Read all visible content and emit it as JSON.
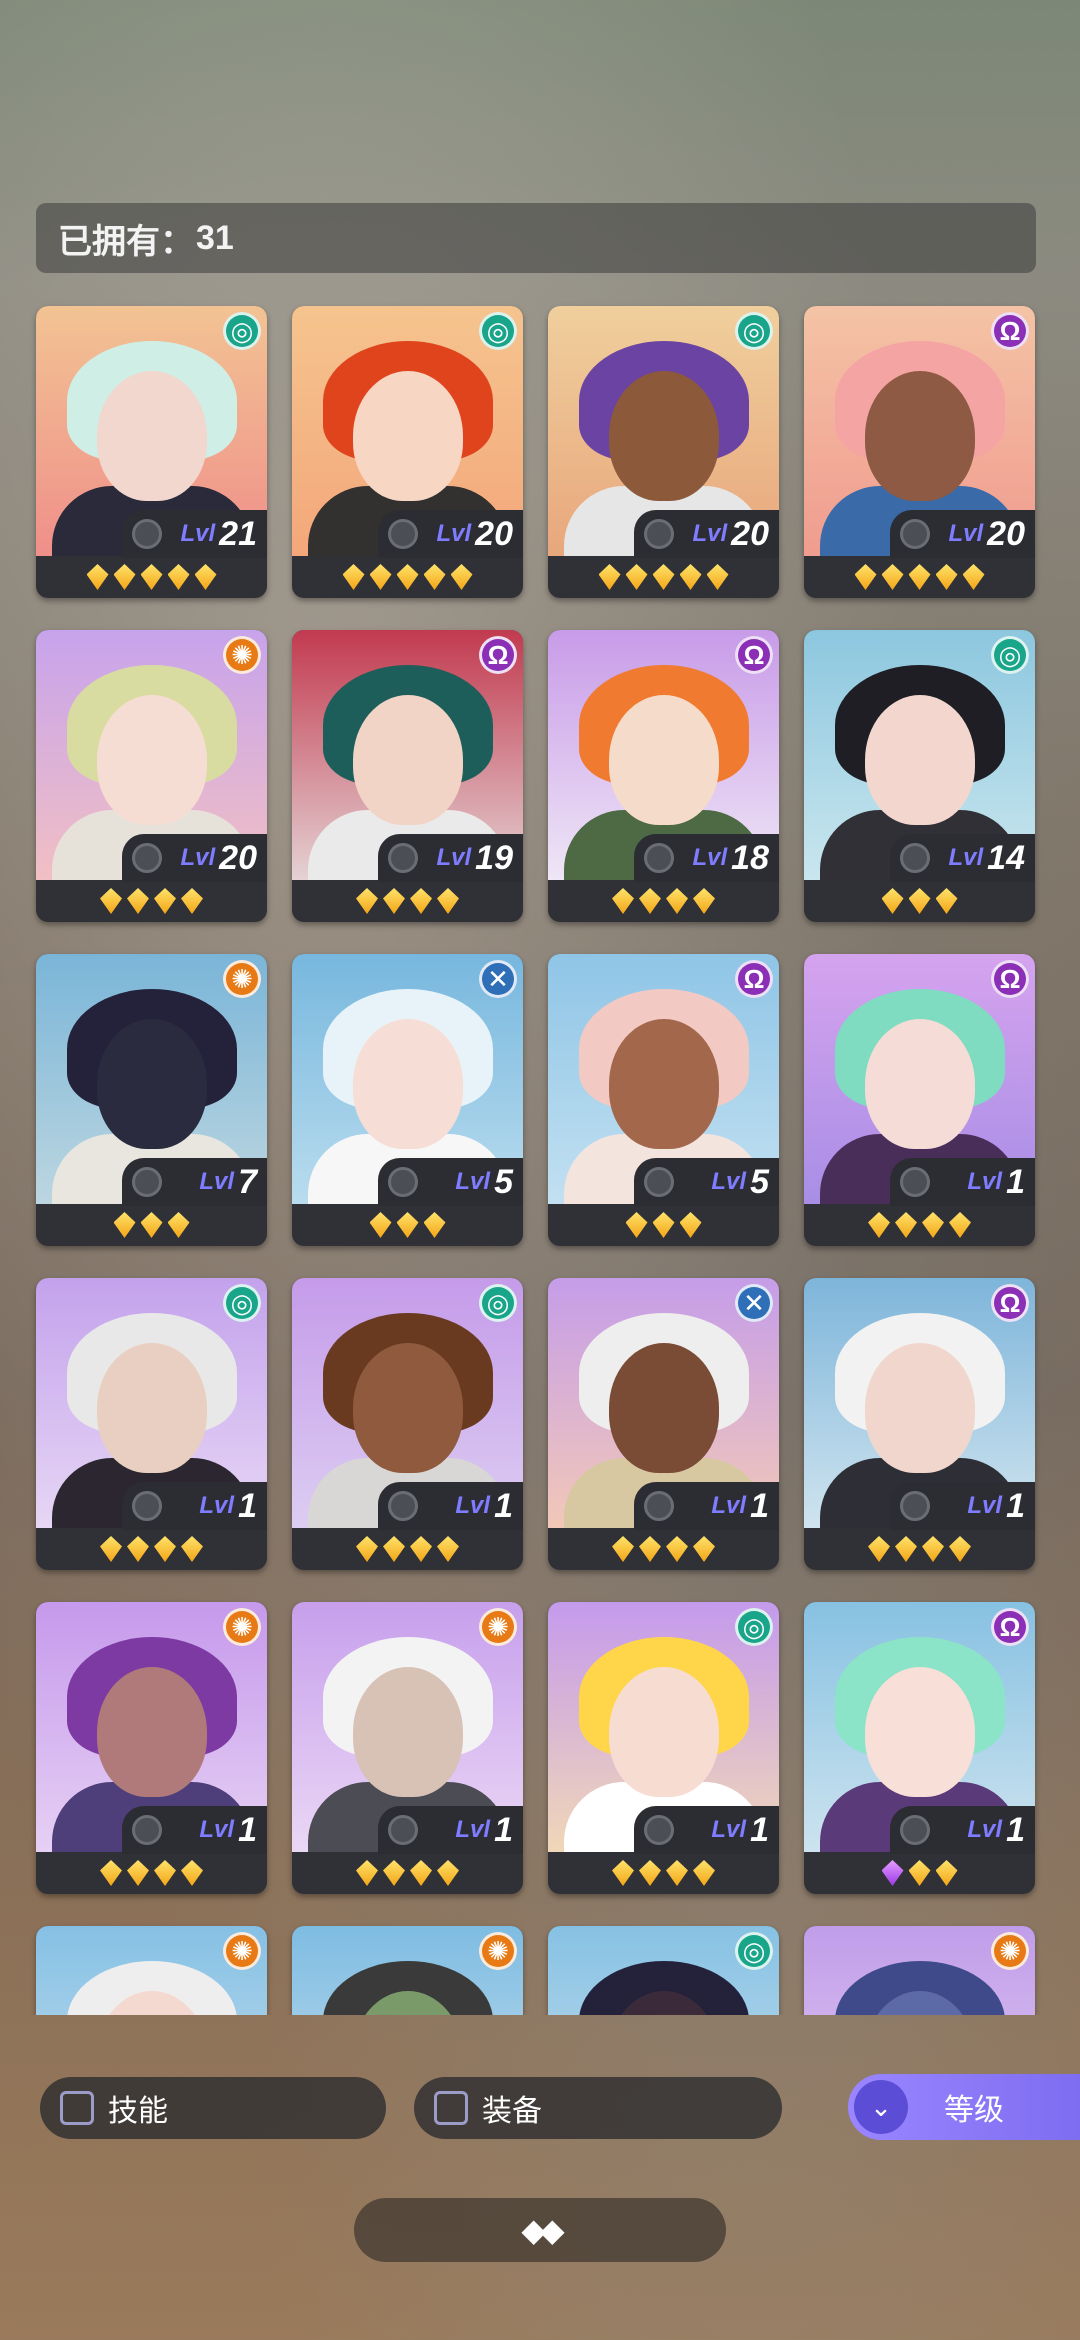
{
  "header": {
    "owned_label": "已拥有：",
    "owned_count": "31"
  },
  "colors": {
    "accent": "#7d6cf0",
    "level_text": "#7f7cff",
    "star_gold": "#f3a516",
    "star_purple": "#9b38e6"
  },
  "filters": {
    "skill_label": "技能",
    "equip_label": "装备",
    "sort_label": "等级"
  },
  "cards": [
    {
      "level": "21",
      "element": "spiral",
      "stars": 5,
      "bg": [
        "#f2c393",
        "#f08f8a"
      ],
      "hair": "#cfeee5",
      "skin": "#f2d7cf",
      "outfit": "#2a2a3a"
    },
    {
      "level": "20",
      "element": "spiral",
      "stars": 5,
      "bg": [
        "#f5c48e",
        "#f4a77b"
      ],
      "hair": "#e0441c",
      "skin": "#f7d6c3",
      "outfit": "#333030"
    },
    {
      "level": "20",
      "element": "spiral",
      "stars": 5,
      "bg": [
        "#f0cf9d",
        "#e8a77c"
      ],
      "hair": "#6b43a3",
      "skin": "#8c5a3a",
      "outfit": "#e6e6e6"
    },
    {
      "level": "20",
      "element": "kaiju",
      "stars": 5,
      "bg": [
        "#f4c3a5",
        "#f09c8f"
      ],
      "hair": "#f5a4a4",
      "skin": "#8e5a43",
      "outfit": "#3a6aa8"
    },
    {
      "level": "20",
      "element": "gear",
      "stars": 4,
      "bg": [
        "#c7a3ec",
        "#f1bfc4"
      ],
      "hair": "#d9dca0",
      "skin": "#f6ddd3",
      "outfit": "#e7e2d9"
    },
    {
      "level": "19",
      "element": "kaiju",
      "stars": 4,
      "bg": [
        "#c23a4f",
        "#e4d2d4"
      ],
      "hair": "#1e5e5a",
      "skin": "#f1d4c5",
      "outfit": "#eaeaea"
    },
    {
      "level": "18",
      "element": "kaiju",
      "stars": 4,
      "bg": [
        "#c89be8",
        "#efe6f6"
      ],
      "hair": "#f07a2f",
      "skin": "#f5dbc9",
      "outfit": "#4d6a45"
    },
    {
      "level": "14",
      "element": "spiral",
      "stars": 3,
      "bg": [
        "#8cc7df",
        "#c9e6ee"
      ],
      "hair": "#1e1e24",
      "skin": "#f3d7cf",
      "outfit": "#303036"
    },
    {
      "level": "7",
      "element": "gear",
      "stars": 3,
      "bg": [
        "#7ab5d8",
        "#bcd6e0"
      ],
      "hair": "#23223a",
      "skin": "#2b2b40",
      "outfit": "#e9e6df"
    },
    {
      "level": "5",
      "element": "cross",
      "stars": 3,
      "bg": [
        "#77b7de",
        "#b9dcee"
      ],
      "hair": "#e7f3f8",
      "skin": "#f6ddd6",
      "outfit": "#f7f7f7"
    },
    {
      "level": "5",
      "element": "kaiju",
      "stars": 3,
      "bg": [
        "#8fc5e6",
        "#c2e0f1"
      ],
      "hair": "#f3c9c4",
      "skin": "#a3674c",
      "outfit": "#f3e4de"
    },
    {
      "level": "1",
      "element": "kaiju",
      "stars": 4,
      "bg": [
        "#d5a3ee",
        "#a88ee6"
      ],
      "hair": "#7fdcc0",
      "skin": "#f6dcd6",
      "outfit": "#4a2e5a"
    },
    {
      "level": "1",
      "element": "spiral",
      "stars": 4,
      "bg": [
        "#c3a2ec",
        "#e7d6f5"
      ],
      "hair": "#e8e8e8",
      "skin": "#e9cfc1",
      "outfit": "#2b2630"
    },
    {
      "level": "1",
      "element": "spiral",
      "stars": 4,
      "bg": [
        "#c59be9",
        "#dccdf2"
      ],
      "hair": "#6a3a20",
      "skin": "#8f5a3d",
      "outfit": "#d9d6d6"
    },
    {
      "level": "1",
      "element": "cross",
      "stars": 4,
      "bg": [
        "#c59de9",
        "#f2c8b8"
      ],
      "hair": "#eeeeee",
      "skin": "#7a4b35",
      "outfit": "#d8c8a2"
    },
    {
      "level": "1",
      "element": "kaiju",
      "stars": 4,
      "bg": [
        "#7eb5da",
        "#cfe4ef"
      ],
      "hair": "#f2f2f2",
      "skin": "#f0d6cc",
      "outfit": "#2e2e36"
    },
    {
      "level": "1",
      "element": "gear",
      "stars": 4,
      "bg": [
        "#c699ec",
        "#e6d0f4"
      ],
      "hair": "#7d3aa2",
      "skin": "#b17a7a",
      "outfit": "#4e3f7a"
    },
    {
      "level": "1",
      "element": "gear",
      "stars": 4,
      "bg": [
        "#c79fec",
        "#ead7f5"
      ],
      "hair": "#f3f3f3",
      "skin": "#d7c2b5",
      "outfit": "#4c4c55"
    },
    {
      "level": "1",
      "element": "spiral",
      "stars": 4,
      "bg": [
        "#c49aec",
        "#f1d7b8"
      ],
      "hair": "#ffd64a",
      "skin": "#f7dcd2",
      "outfit": "#ffffff"
    },
    {
      "level": "1",
      "element": "kaiju",
      "stars": 3,
      "purple_first": true,
      "bg": [
        "#87c1e2",
        "#cde3ef"
      ],
      "hair": "#8be3c8",
      "skin": "#f8dfd8",
      "outfit": "#5b3a7a"
    },
    {
      "level": "",
      "element": "gear",
      "stars": 0,
      "bg": [
        "#85c0e4",
        "#cfe4f0"
      ],
      "hair": "#eeeeee",
      "skin": "#f3d9cf",
      "outfit": "#ffffff"
    },
    {
      "level": "",
      "element": "gear",
      "stars": 0,
      "bg": [
        "#7ebce2",
        "#cfe4f0"
      ],
      "hair": "#3a3a3a",
      "skin": "#7a9a6a",
      "outfit": "#ffffff"
    },
    {
      "level": "",
      "element": "spiral",
      "stars": 0,
      "bg": [
        "#86c1e3",
        "#cfe4f0"
      ],
      "hair": "#23223a",
      "skin": "#3a2a3a",
      "outfit": "#ffffff"
    },
    {
      "level": "",
      "element": "gear",
      "stars": 0,
      "bg": [
        "#c19de9",
        "#e4d0f4"
      ],
      "hair": "#3f4a8a",
      "skin": "#5d6aa8",
      "outfit": "#ffffff"
    }
  ],
  "icons": {
    "spiral": "◎",
    "kaiju": "Ω",
    "gear": "✺",
    "cross": "✕",
    "sort": "⌄",
    "handle": "◆◆"
  },
  "lvl_label": "Lvl"
}
